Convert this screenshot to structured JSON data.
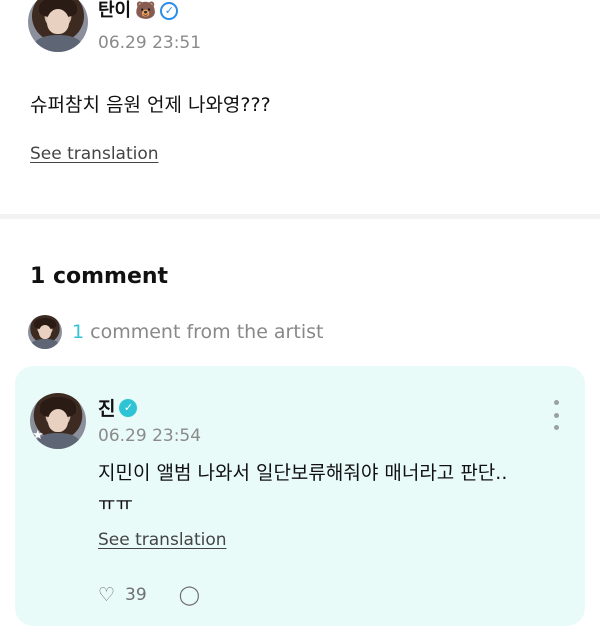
{
  "post": {
    "author": "탄이",
    "author_emoji": "🐻",
    "timestamp": "06.29 23:51",
    "body": "슈퍼참치 음원 언제 나와영???",
    "translate_label": "See translation"
  },
  "comments": {
    "title": "1 comment",
    "artist_count": "1",
    "artist_label": " comment from the artist"
  },
  "comment": {
    "author": "진",
    "timestamp": "06.29 23:54",
    "body_line1": "지민이 앨범 나와서 일단보류해줘야 매너라고 판단..",
    "body_line2": "ㅠㅠ",
    "translate_label": "See translation",
    "like_count": "39"
  },
  "colors": {
    "accent": "#34c3d4",
    "card_bg": "#e9fbf8"
  },
  "icons": {
    "verified": "verified-badge-icon",
    "more": "more-vertical-icon",
    "like": "like-icon",
    "reply": "reply-icon"
  }
}
